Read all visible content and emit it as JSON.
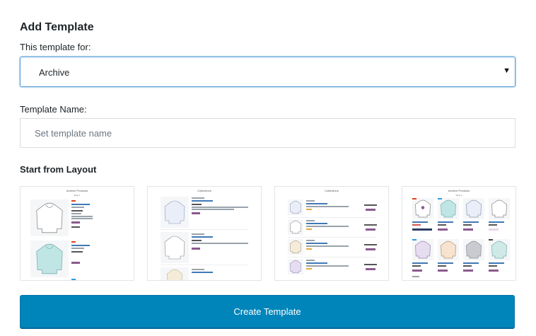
{
  "form": {
    "title": "Add Template",
    "template_for_label": "This template for:",
    "template_for_value": "Archive",
    "template_name_label": "Template Name:",
    "template_name_placeholder": "Set template name",
    "layout_label": "Start from Layout",
    "submit_label": "Create Template"
  },
  "layouts": [
    {
      "title": "Archive Products",
      "subtitle": "Style 1"
    },
    {
      "title": "Collections"
    },
    {
      "title": "Collections"
    },
    {
      "title": "Archive Products",
      "subtitle": "Style 2"
    }
  ],
  "colors": {
    "primary_button": "#0085ba",
    "focus_border": "#5b9dd9"
  }
}
